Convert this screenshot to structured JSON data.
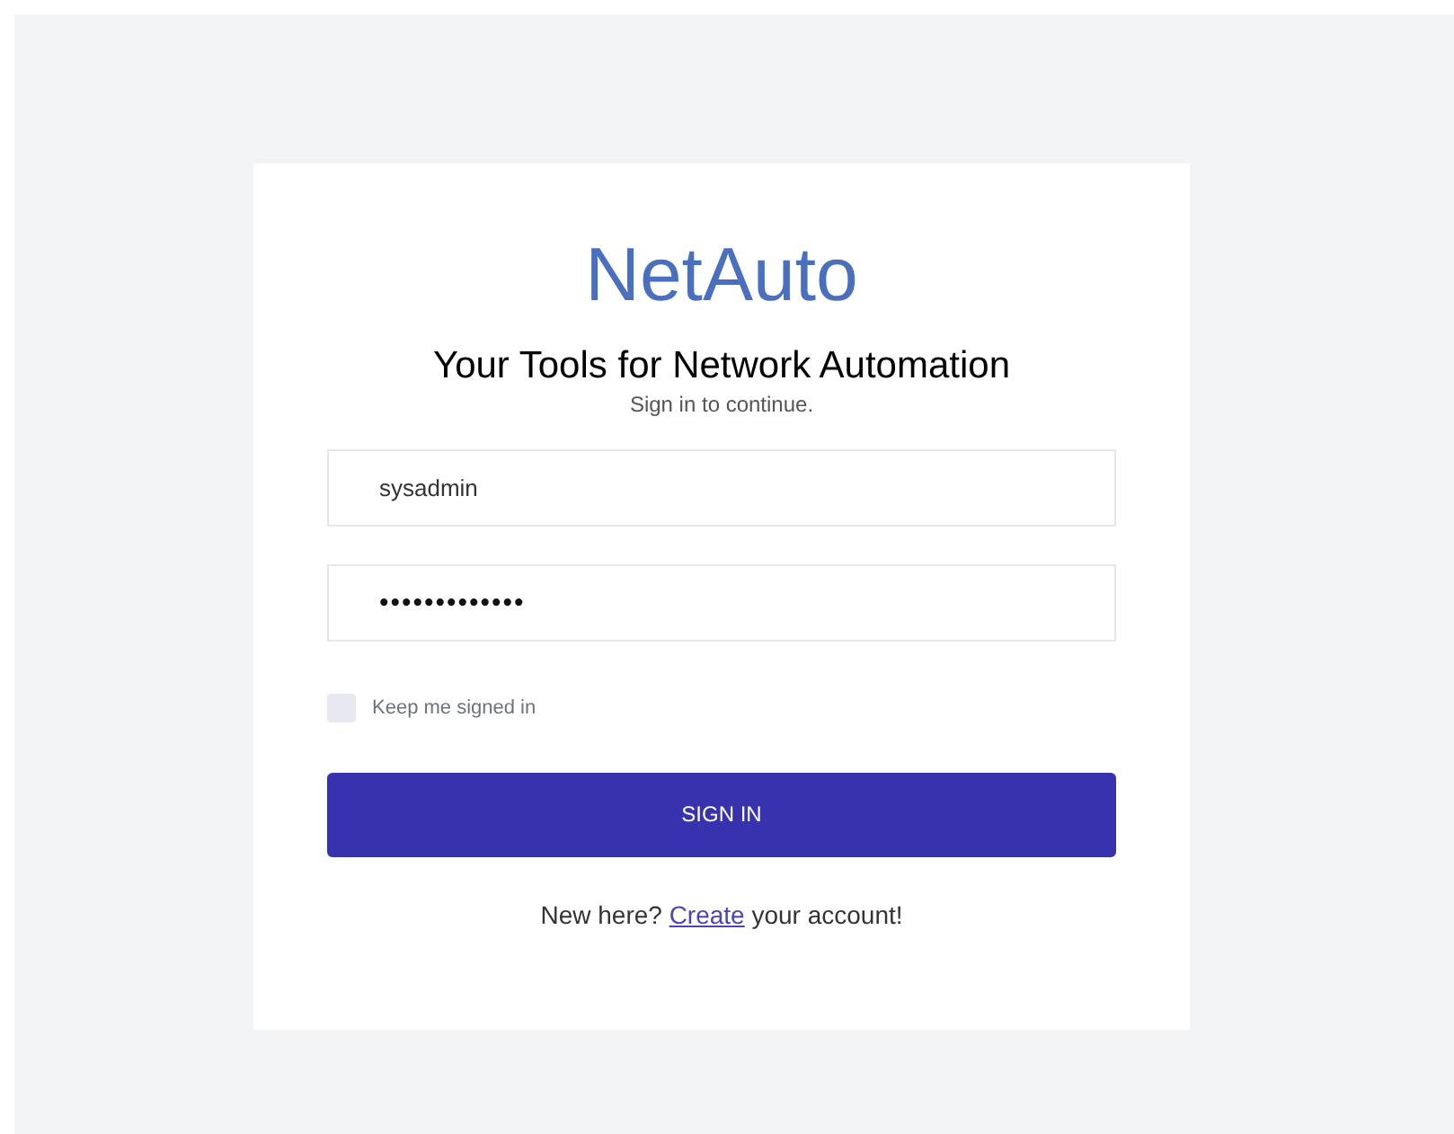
{
  "brand": "NetAuto",
  "heading": "Your Tools for Network Automation",
  "subheading": "Sign in to continue.",
  "fields": [
    {
      "kind": "text",
      "value": "sysadmin"
    },
    {
      "kind": "password",
      "value": "•••••••••••••"
    }
  ],
  "remember": {
    "label": "Keep me signed in",
    "checked": false
  },
  "submit": "SIGN IN",
  "footer": {
    "before": "New here? ",
    "link": "Create",
    "after": " your account!"
  }
}
